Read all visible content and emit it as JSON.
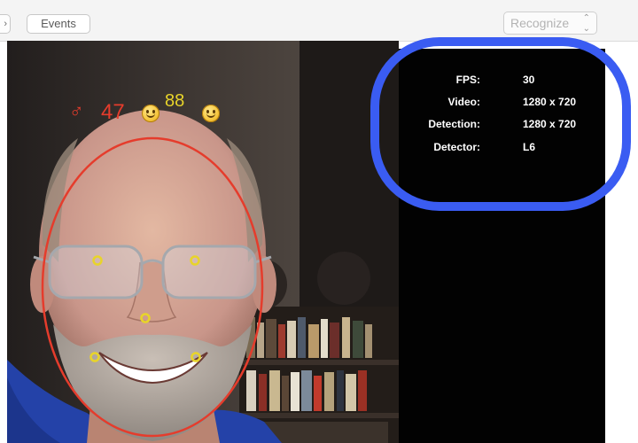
{
  "toolbar": {
    "events_label": "Events",
    "detector_select": {
      "value": "Recognize",
      "arrow_icon": "up-down-chevron-icon"
    },
    "stepper_icon": "chevron-icon"
  },
  "overlay": {
    "gender_symbol": "♂",
    "age": "47",
    "score": "88",
    "emoji_icon": "smiley-icon",
    "colors": {
      "face_ellipse": "#e53c2c",
      "landmarks": "#e8d42a",
      "highlight": "#3a5cf2"
    }
  },
  "stats": {
    "rows": [
      {
        "label": "FPS:",
        "value": "30"
      },
      {
        "label": "Video:",
        "value": "1280 x 720"
      },
      {
        "label": "Detection:",
        "value": "1280 x 720"
      },
      {
        "label": "Detector:",
        "value": "L6"
      }
    ]
  }
}
